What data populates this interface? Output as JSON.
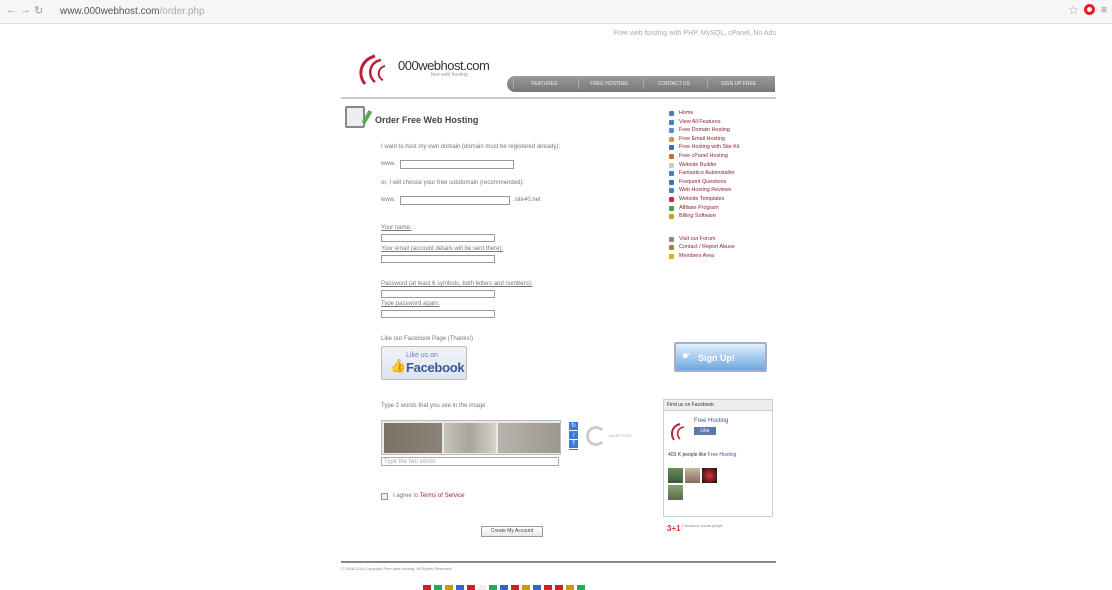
{
  "browser": {
    "url": "www.000webhost.com/order.php",
    "url_host": "www.000webhost.com",
    "url_path": "/order.php",
    "back": "←",
    "forward": "→",
    "reload": "↻",
    "bookmark": "☆",
    "menu": "≡"
  },
  "header": {
    "topline": "Free web hosting with PHP, MySQL, cPanel, No Ads",
    "logo_text": "000webhost.com",
    "logo_sub": "free web hosting",
    "nav": [
      "FEATURES",
      "FREE HOSTING",
      "CONTACT US",
      "SIGN UP FREE"
    ]
  },
  "form": {
    "title": "Order Free Web Hosting",
    "own_domain_label": "I want to host my own domain (domain must be registered already):",
    "www_label": "www.",
    "subdomain_label": "or, I will choose your free subdomain (recommended):",
    "subdomain_suffix": ".site40.net",
    "name_label": "Your name:",
    "email_label": "Your email (account details will be sent there):",
    "password_label": "Password (at least 6 symbols, both letters and numbers):",
    "password_again_label": "Type password again:",
    "facebook_prompt": "Like our Facebook Page (Thanks!)",
    "fb_like_small": "Like us on",
    "fb_like_word": "Facebook",
    "captcha_prompt": "Type 2 words that you see in the image:",
    "captcha_placeholder": "Type the two words",
    "captcha_brand": "reCAPTCHA",
    "captcha_buttons": [
      "↻",
      "♪",
      "?"
    ],
    "agree_text": "I agree to",
    "agree_link": "Terms of Service",
    "submit_label": "Create My Account"
  },
  "sidebar": {
    "items": [
      {
        "label": "Home",
        "color": "#4a7cc0"
      },
      {
        "label": "View All Features",
        "color": "#4a7cc0"
      },
      {
        "label": "Free Domain Hosting",
        "color": "#5b8bc8"
      },
      {
        "label": "Free Email Hosting",
        "color": "#c8a040"
      },
      {
        "label": "Free Hosting with Site Kit",
        "color": "#3f6fb0"
      },
      {
        "label": "Free cPanel Hosting",
        "color": "#d07030"
      },
      {
        "label": "Website Builder",
        "color": "#cccccc"
      },
      {
        "label": "Fantastico Autoinstaller",
        "color": "#4a7cc0"
      },
      {
        "label": "Frequent Questions",
        "color": "#3f6fb0"
      },
      {
        "label": "Web Hosting Reviews",
        "color": "#4a7cc0"
      },
      {
        "label": "Website Templates",
        "color": "#c03030"
      },
      {
        "label": "Affiliate Program",
        "color": "#50a040"
      },
      {
        "label": "Billing Software",
        "color": "#d0a020"
      }
    ],
    "extra": [
      {
        "label": "Visit our Forum",
        "color": "#888888"
      },
      {
        "label": "Contact / Report Abuse",
        "color": "#b08030"
      },
      {
        "label": "Members Area",
        "color": "#e0b020"
      }
    ],
    "signup_label": "Sign Up!",
    "signup_icon": "☛"
  },
  "facebook_box": {
    "header": "Find us on Facebook",
    "page_name": "Free Hosting",
    "like_label": "Like",
    "count_prefix": "403 K people like",
    "count_page": "Free Hosting",
    "plugin_icon": "3+1",
    "plugin_text": "Facebook social plugin"
  },
  "footer": {
    "copyright": "© 2008-2014 Copyright Free web hosting. All Rights Reserved.",
    "flags": [
      "#c22",
      "#2a5",
      "#c90",
      "#36c",
      "#c22",
      "#eee",
      "#2a5",
      "#36c",
      "#c22",
      "#c90",
      "#36c",
      "#c22",
      "#c22",
      "#c90",
      "#2a5"
    ]
  },
  "colors": {
    "accent": "#8b2332",
    "link": "#3b5998",
    "signup": "#6fa6dd"
  }
}
